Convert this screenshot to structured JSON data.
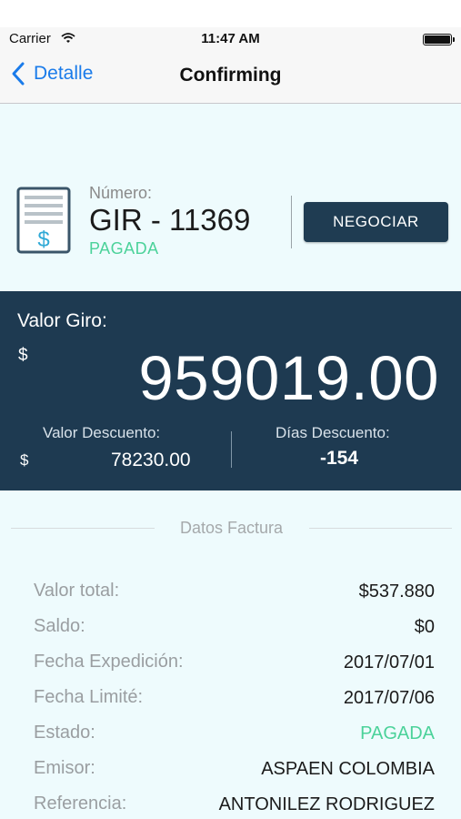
{
  "status_bar": {
    "carrier": "Carrier",
    "time": "11:47 AM",
    "wifi_icon": "wifi-icon",
    "battery_icon": "battery-icon"
  },
  "nav": {
    "back_label": "Detalle",
    "title": "Confirming"
  },
  "header": {
    "number_label": "Número:",
    "number_value": "GIR - 11369",
    "status": "PAGADA",
    "negociar_label": "NEGOCIAR",
    "icon": "invoice-document-icon"
  },
  "panel": {
    "valor_giro_label": "Valor Giro:",
    "currency": "$",
    "valor_giro_amount": "959019.00",
    "valor_descuento_label": "Valor Descuento:",
    "valor_descuento_currency": "$",
    "valor_descuento_value": "78230.00",
    "dias_descuento_label": "Días Descuento:",
    "dias_descuento_value": "-154"
  },
  "datos": {
    "section_title": "Datos Factura",
    "rows": [
      {
        "label": "Valor total:",
        "value": "$537.880"
      },
      {
        "label": "Saldo:",
        "value": "$0"
      },
      {
        "label": "Fecha Expedición:",
        "value": "2017/07/01"
      },
      {
        "label": "Fecha Limité:",
        "value": "2017/07/06"
      },
      {
        "label": "Estado:",
        "value": "PAGADA"
      },
      {
        "label": "Emisor:",
        "value": "ASPAEN COLOMBIA"
      },
      {
        "label": "Referencia:",
        "value": "ANTONILEZ RODRIGUEZ"
      }
    ]
  },
  "colors": {
    "accent": "#1a7bea",
    "panel": "#1e3a51",
    "success": "#4bd29a",
    "background": "#eefbfd"
  }
}
